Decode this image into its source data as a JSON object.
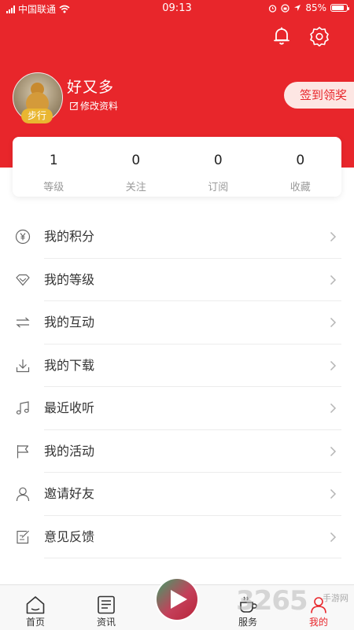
{
  "status_bar": {
    "carrier": "中国联通",
    "time": "09:13",
    "battery": "85%",
    "battery_level": 0.85
  },
  "header": {
    "bell_icon": "bell-icon",
    "settings_icon": "gear-icon"
  },
  "profile": {
    "username": "好又多",
    "edit_label": "修改资料",
    "level_badge": "步行",
    "checkin_label": "签到领奖"
  },
  "stats": [
    {
      "value": "1",
      "label": "等级"
    },
    {
      "value": "0",
      "label": "关注"
    },
    {
      "value": "0",
      "label": "订阅"
    },
    {
      "value": "0",
      "label": "收藏"
    }
  ],
  "menu": [
    {
      "label": "我的积分",
      "icon": "yen-coin-icon"
    },
    {
      "label": "我的等级",
      "icon": "diamond-icon"
    },
    {
      "label": "我的互动",
      "icon": "swap-arrows-icon"
    },
    {
      "label": "我的下载",
      "icon": "download-icon"
    },
    {
      "label": "最近收听",
      "icon": "music-note-icon"
    },
    {
      "label": "我的活动",
      "icon": "flag-icon"
    },
    {
      "label": "邀请好友",
      "icon": "person-icon"
    },
    {
      "label": "意见反馈",
      "icon": "feedback-icon"
    }
  ],
  "tabs": [
    {
      "label": "首页",
      "icon": "home-icon"
    },
    {
      "label": "资讯",
      "icon": "news-icon"
    },
    {
      "label": "服务",
      "icon": "coffee-cup-icon"
    },
    {
      "label": "我的",
      "icon": "person-icon"
    }
  ],
  "colors": {
    "brand_red": "#e8262b",
    "badge_gold": "#e9b631",
    "checkin_bg": "#fde6e3"
  },
  "watermark": {
    "main": "3265",
    "sub": "手游网"
  }
}
